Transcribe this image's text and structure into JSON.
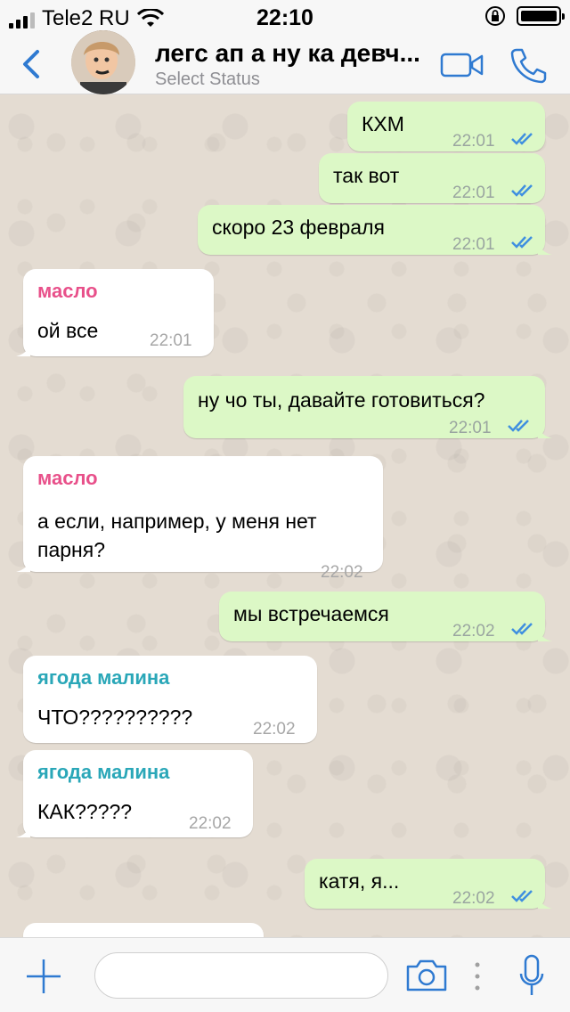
{
  "status_bar": {
    "carrier": "Tele2 RU",
    "time": "22:10"
  },
  "header": {
    "back_icon": "chevron-left-icon",
    "title": "легс ап а ну ка девч...",
    "subtitle": "Select Status",
    "accent_color": "#2f7ad1"
  },
  "colors": {
    "outgoing_bubble": "#dcf8c6",
    "incoming_bubble": "#ffffff",
    "read_ticks": "#3f8fe0",
    "sender_maslo": "#e8508a",
    "sender_yagoda": "#2aa7b8"
  },
  "messages": [
    {
      "direction": "out",
      "text": "КХМ",
      "time": "22:01",
      "status": "read"
    },
    {
      "direction": "out",
      "text": "так вот",
      "time": "22:01",
      "status": "read"
    },
    {
      "direction": "out",
      "text": "скоро 23 февраля",
      "time": "22:01",
      "status": "read"
    },
    {
      "direction": "in",
      "sender": "масло",
      "text": "ой все",
      "time": "22:01"
    },
    {
      "direction": "out",
      "text": "ну чо ты, давайте готовиться?",
      "time": "22:01",
      "status": "read"
    },
    {
      "direction": "in",
      "sender": "масло",
      "text_lines": [
        "а если, например, у меня нет",
        "парня?"
      ],
      "time": "22:02"
    },
    {
      "direction": "out",
      "text": "мы встречаемся",
      "time": "22:02",
      "status": "read"
    },
    {
      "direction": "in",
      "sender": "ягода малина",
      "text": "ЧТО??????????",
      "time": "22:02"
    },
    {
      "direction": "in",
      "sender": "ягода малина",
      "text": "КАК?????",
      "time": "22:02"
    },
    {
      "direction": "out",
      "text": "катя, я...",
      "time": "22:02",
      "status": "read"
    }
  ],
  "input_bar": {
    "plus_icon": "plus-icon",
    "placeholder": "",
    "camera_icon": "camera-icon",
    "mic_icon": "microphone-icon"
  }
}
